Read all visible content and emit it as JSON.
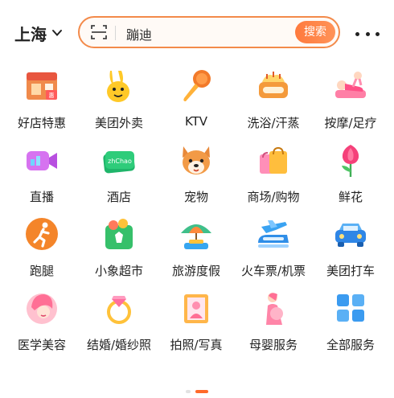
{
  "header": {
    "city": "上海",
    "search_placeholder": "蹦迪",
    "search_button": "搜索"
  },
  "categories": [
    {
      "label": "好店特惠",
      "icon": "storefront-icon"
    },
    {
      "label": "美团外卖",
      "icon": "kangaroo-icon"
    },
    {
      "label": "KTV",
      "icon": "microphone-icon"
    },
    {
      "label": "洗浴/汗蒸",
      "icon": "bath-icon"
    },
    {
      "label": "按摩/足疗",
      "icon": "massage-icon"
    },
    {
      "label": "直播",
      "icon": "video-camera-icon"
    },
    {
      "label": "酒店",
      "icon": "hotel-card-icon"
    },
    {
      "label": "宠物",
      "icon": "dog-icon"
    },
    {
      "label": "商场/购物",
      "icon": "shopping-bag-icon"
    },
    {
      "label": "鲜花",
      "icon": "flower-icon"
    },
    {
      "label": "跑腿",
      "icon": "runner-icon"
    },
    {
      "label": "小象超市",
      "icon": "grocery-icon"
    },
    {
      "label": "旅游度假",
      "icon": "beach-umbrella-icon"
    },
    {
      "label": "火车票/机票",
      "icon": "train-plane-icon"
    },
    {
      "label": "美团打车",
      "icon": "taxi-icon"
    },
    {
      "label": "医学美容",
      "icon": "beauty-face-icon"
    },
    {
      "label": "结婚/婚纱照",
      "icon": "ring-icon"
    },
    {
      "label": "拍照/写真",
      "icon": "photo-frame-icon"
    },
    {
      "label": "母婴服务",
      "icon": "mother-baby-icon"
    },
    {
      "label": "全部服务",
      "icon": "grid-icon"
    }
  ],
  "colors": {
    "accent": "#ff7a3d",
    "pager_active": "#ff6a2a"
  }
}
